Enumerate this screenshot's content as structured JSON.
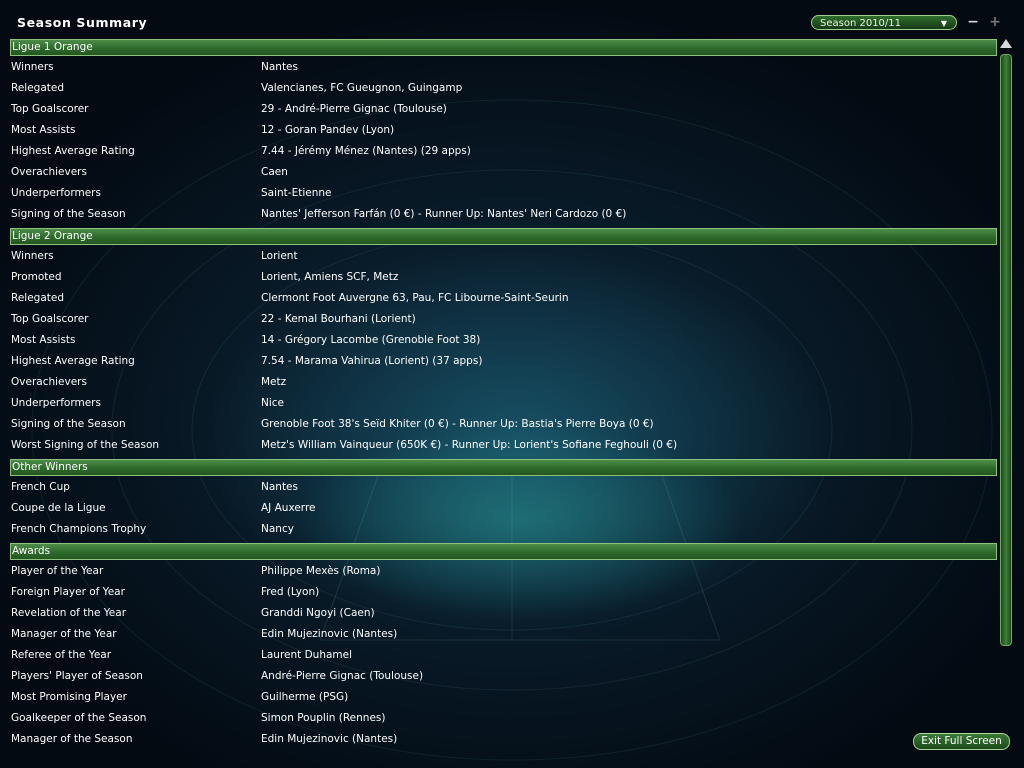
{
  "header": {
    "title": "Season Summary",
    "season_select": "Season 2010/11",
    "minimize": "−",
    "maximize": "+"
  },
  "sections": [
    {
      "title": "Ligue 1 Orange",
      "rows": [
        {
          "label": "Winners",
          "value": "Nantes"
        },
        {
          "label": "Relegated",
          "value": "Valencianes, FC Gueugnon, Guingamp"
        },
        {
          "label": "Top Goalscorer",
          "value": "29 - André-Pierre Gignac (Toulouse)"
        },
        {
          "label": "Most Assists",
          "value": "12 - Goran Pandev (Lyon)"
        },
        {
          "label": "Highest Average Rating",
          "value": "7.44 - Jérémy Ménez (Nantes) (29 apps)"
        },
        {
          "label": "Overachievers",
          "value": "Caen"
        },
        {
          "label": "Underperformers",
          "value": "Saint-Etienne"
        },
        {
          "label": "Signing of the Season",
          "value": "Nantes' Jefferson Farfán (0 €) - Runner Up: Nantes' Neri Cardozo (0 €)"
        }
      ]
    },
    {
      "title": "Ligue 2 Orange",
      "rows": [
        {
          "label": "Winners",
          "value": "Lorient"
        },
        {
          "label": "Promoted",
          "value": "Lorient, Amiens SCF, Metz"
        },
        {
          "label": "Relegated",
          "value": "Clermont Foot Auvergne 63, Pau, FC Libourne-Saint-Seurin"
        },
        {
          "label": "Top Goalscorer",
          "value": "22 - Kemal Bourhani (Lorient)"
        },
        {
          "label": "Most Assists",
          "value": "14 - Grégory Lacombe (Grenoble Foot 38)"
        },
        {
          "label": "Highest Average Rating",
          "value": "7.54 - Marama Vahirua (Lorient) (37 apps)"
        },
        {
          "label": "Overachievers",
          "value": "Metz"
        },
        {
          "label": "Underperformers",
          "value": "Nice"
        },
        {
          "label": "Signing of the Season",
          "value": "Grenoble Foot 38's Seïd Khiter (0 €) - Runner Up: Bastia's Pierre Boya (0 €)"
        },
        {
          "label": "Worst Signing of the Season",
          "value": "Metz's William Vainqueur (650K €) - Runner Up: Lorient's Sofiane Feghouli (0 €)"
        }
      ]
    },
    {
      "title": "Other Winners",
      "rows": [
        {
          "label": "French Cup",
          "value": "Nantes"
        },
        {
          "label": "Coupe de la Ligue",
          "value": "AJ Auxerre"
        },
        {
          "label": "French Champions Trophy",
          "value": "Nancy"
        }
      ]
    },
    {
      "title": "Awards",
      "rows": [
        {
          "label": "Player of the Year",
          "value": "Philippe Mexès (Roma)"
        },
        {
          "label": "Foreign Player of Year",
          "value": "Fred (Lyon)"
        },
        {
          "label": "Revelation of the Year",
          "value": "Granddi Ngoyi (Caen)"
        },
        {
          "label": "Manager of the Year",
          "value": "Edin Mujezinovic (Nantes)"
        },
        {
          "label": "Referee of the Year",
          "value": "Laurent Duhamel"
        },
        {
          "label": "Players' Player of Season",
          "value": "André-Pierre Gignac (Toulouse)"
        },
        {
          "label": "Most Promising Player",
          "value": "Guilherme (PSG)"
        },
        {
          "label": "Goalkeeper of the Season",
          "value": "Simon Pouplin (Rennes)"
        },
        {
          "label": "Manager of the Season",
          "value": "Edin Mujezinovic (Nantes)"
        }
      ]
    }
  ],
  "footer": {
    "exit_button": "Exit Full Screen"
  },
  "colors": {
    "header_bar": "#2e6a2c",
    "header_border": "#8cc27e",
    "background": "#03080f"
  }
}
